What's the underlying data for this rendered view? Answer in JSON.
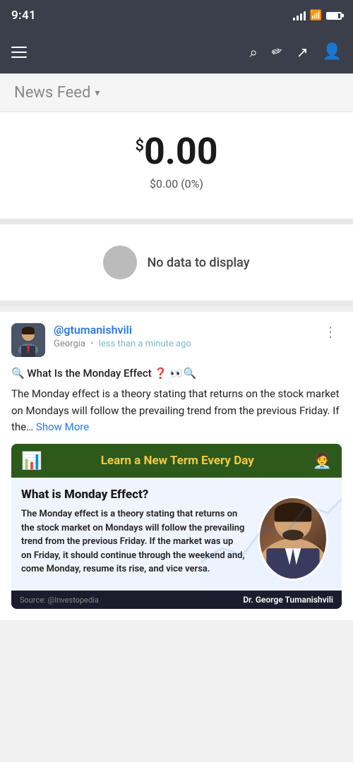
{
  "status_bar": {
    "time": "9:41",
    "battery_level": 85
  },
  "top_nav": {
    "menu_icon_label": "menu",
    "search_icon_label": "search",
    "pencil_icon_label": "pencil",
    "share_icon_label": "share",
    "profile_icon_label": "profile"
  },
  "news_feed": {
    "title": "News Feed",
    "chevron": "▾"
  },
  "portfolio": {
    "amount_main": "0.00",
    "amount_prefix": "$",
    "change": "$0.00 (0%)",
    "no_data_text": "No data to display"
  },
  "post": {
    "author_handle": "@gtumanishvili",
    "author_location": "Georgia",
    "author_time": "less than a minute ago",
    "post_title": "🔍 What Is the Monday Effect ❓ 👀🔍",
    "post_body": "The Monday effect is a theory stating that returns on the stock market on Mondays will follow the prevailing trend from the previous Friday. If the…",
    "show_more_label": "Show More",
    "more_icon": "⋮"
  },
  "image_card": {
    "header_icon_left": "📊",
    "header_text": "Learn a New Term Every Day",
    "header_icon_right": "🧑‍💼",
    "card_title": "What is Monday Effect?",
    "card_description": "The Monday effect is a theory stating that returns on the stock market on Mondays will follow the prevailing trend from the previous Friday. If the market was up on Friday, it should continue through the weekend and, come Monday, resume its rise, and vice versa.",
    "source_label": "Source: @Investopedia",
    "person_name": "Dr. George Tumanishvili",
    "person_emoji": "👨"
  }
}
